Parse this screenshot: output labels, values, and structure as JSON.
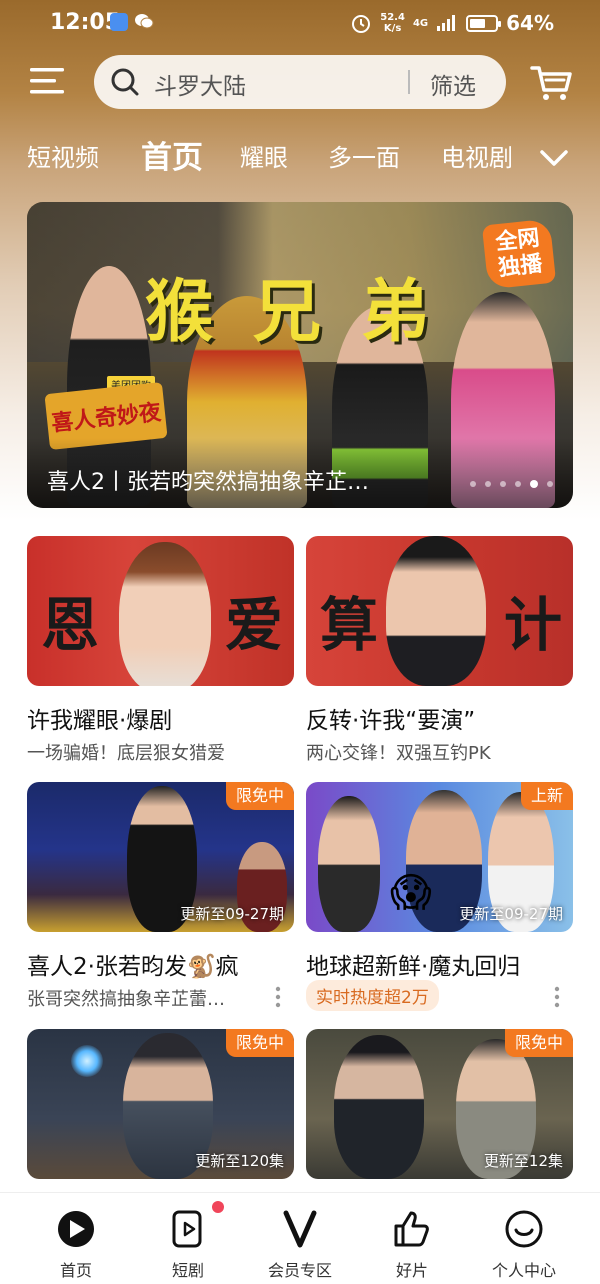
{
  "status_bar": {
    "time": "12:05",
    "speed_value": "52.4",
    "speed_unit": "K/s",
    "network": "4G",
    "battery_percent": "64%",
    "battery_level": 0.64
  },
  "search": {
    "query": "斗罗大陆",
    "filter_label": "筛选"
  },
  "tabs": [
    {
      "label": "短视频",
      "active": false
    },
    {
      "label": "首页",
      "active": true
    },
    {
      "label": "耀眼",
      "active": false
    },
    {
      "label": "多一面",
      "active": false
    },
    {
      "label": "电视剧",
      "active": false
    }
  ],
  "banner": {
    "title": "猴兄弟",
    "caption": "喜人2丨张若昀突然搞抽象辛芷…",
    "badge": "全网独播",
    "logo": "喜人奇妙夜",
    "logo_sponsor": "美团团购",
    "dots_count": 6,
    "active_dot": 4
  },
  "cards": [
    {
      "title": "许我耀眼·爆剧",
      "subtitle": "一场骗婚！底层狠女猎爱",
      "poster_text_left": "恩",
      "poster_text_right": "爱",
      "badge": "",
      "update": ""
    },
    {
      "title": "反转·许我“要演”",
      "subtitle": "两心交锋！双强互钓PK",
      "poster_text_left": "算",
      "poster_text_right": "计",
      "badge": "",
      "update": ""
    },
    {
      "title": "喜人2·张若昀发🐒疯",
      "subtitle": "张哥突然搞抽象辛芷蕾…",
      "badge": "限免中",
      "update": "更新至09-27期"
    },
    {
      "title": "地球超新鲜·魔丸回归",
      "subtitle_tag": "实时热度超2万",
      "badge": "上新",
      "update": "更新至09-27期"
    },
    {
      "title": "",
      "badge": "限免中",
      "update": "更新至120集"
    },
    {
      "title": "",
      "badge": "限免中",
      "update": "更新至12集"
    }
  ],
  "bottom_nav": [
    {
      "label": "首页",
      "icon": "play-home-icon"
    },
    {
      "label": "短剧",
      "icon": "short-drama-icon",
      "has_dot": true
    },
    {
      "label": "会员专区",
      "icon": "vip-v-icon"
    },
    {
      "label": "好片",
      "icon": "thumbs-up-icon"
    },
    {
      "label": "个人中心",
      "icon": "smiley-profile-icon"
    }
  ],
  "colors": {
    "accent": "#f37920",
    "badge_dot": "#f0455a",
    "banner_title": "#f3e03a"
  }
}
